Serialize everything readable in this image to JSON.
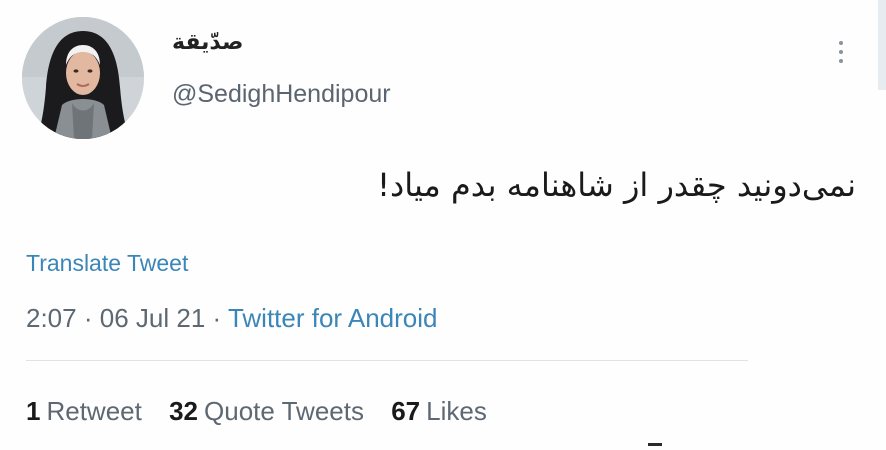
{
  "author": {
    "display_name": "صدّيقة",
    "handle": "@SedighHendipour"
  },
  "tweet": {
    "text": "نمی‌دونید چقدر از شاهنامه بدم میاد!",
    "translate_label": "Translate Tweet",
    "time": "2:07",
    "date": "06 Jul 21",
    "separator": "·",
    "source": "Twitter for Android"
  },
  "stats": {
    "retweets_count": "1",
    "retweets_label": "Retweet",
    "quotes_count": "32",
    "quotes_label": "Quote Tweets",
    "likes_count": "67",
    "likes_label": "Likes"
  },
  "colors": {
    "link": "#3b86b8",
    "secondary_text": "#5e6872",
    "primary_text": "#1a1a1a"
  }
}
